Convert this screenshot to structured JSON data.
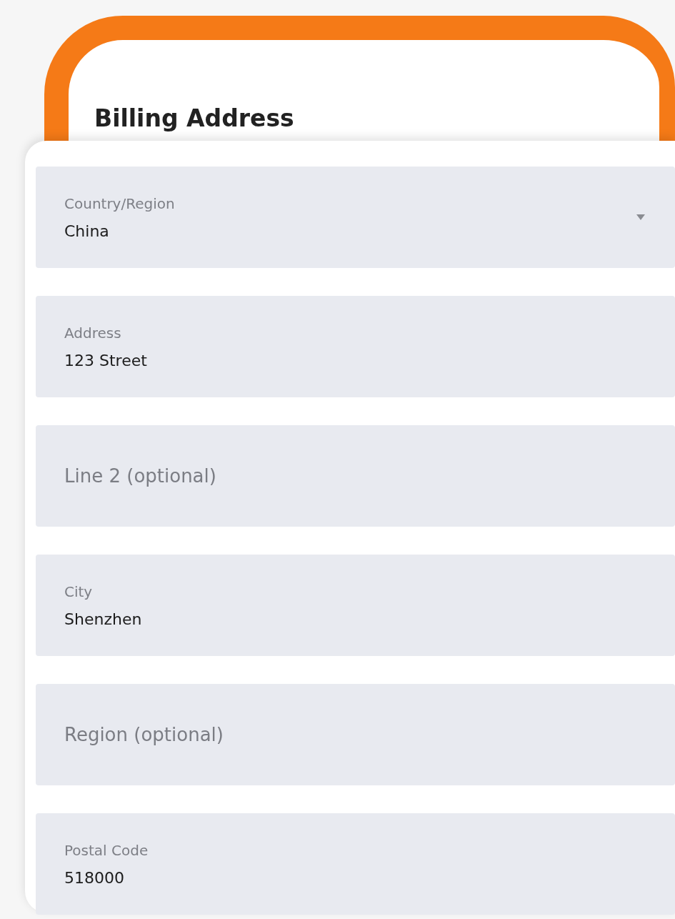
{
  "title": "Billing Address",
  "fields": [
    {
      "kind": "select",
      "label": "Country/Region",
      "value": "China"
    },
    {
      "kind": "text",
      "label": "Address",
      "value": "123 Street"
    },
    {
      "kind": "text",
      "placeholder": "Line 2 (optional)"
    },
    {
      "kind": "text",
      "label": "City",
      "value": "Shenzhen"
    },
    {
      "kind": "text",
      "placeholder": "Region (optional)"
    },
    {
      "kind": "text",
      "label": "Postal Code",
      "value": "518000"
    }
  ]
}
